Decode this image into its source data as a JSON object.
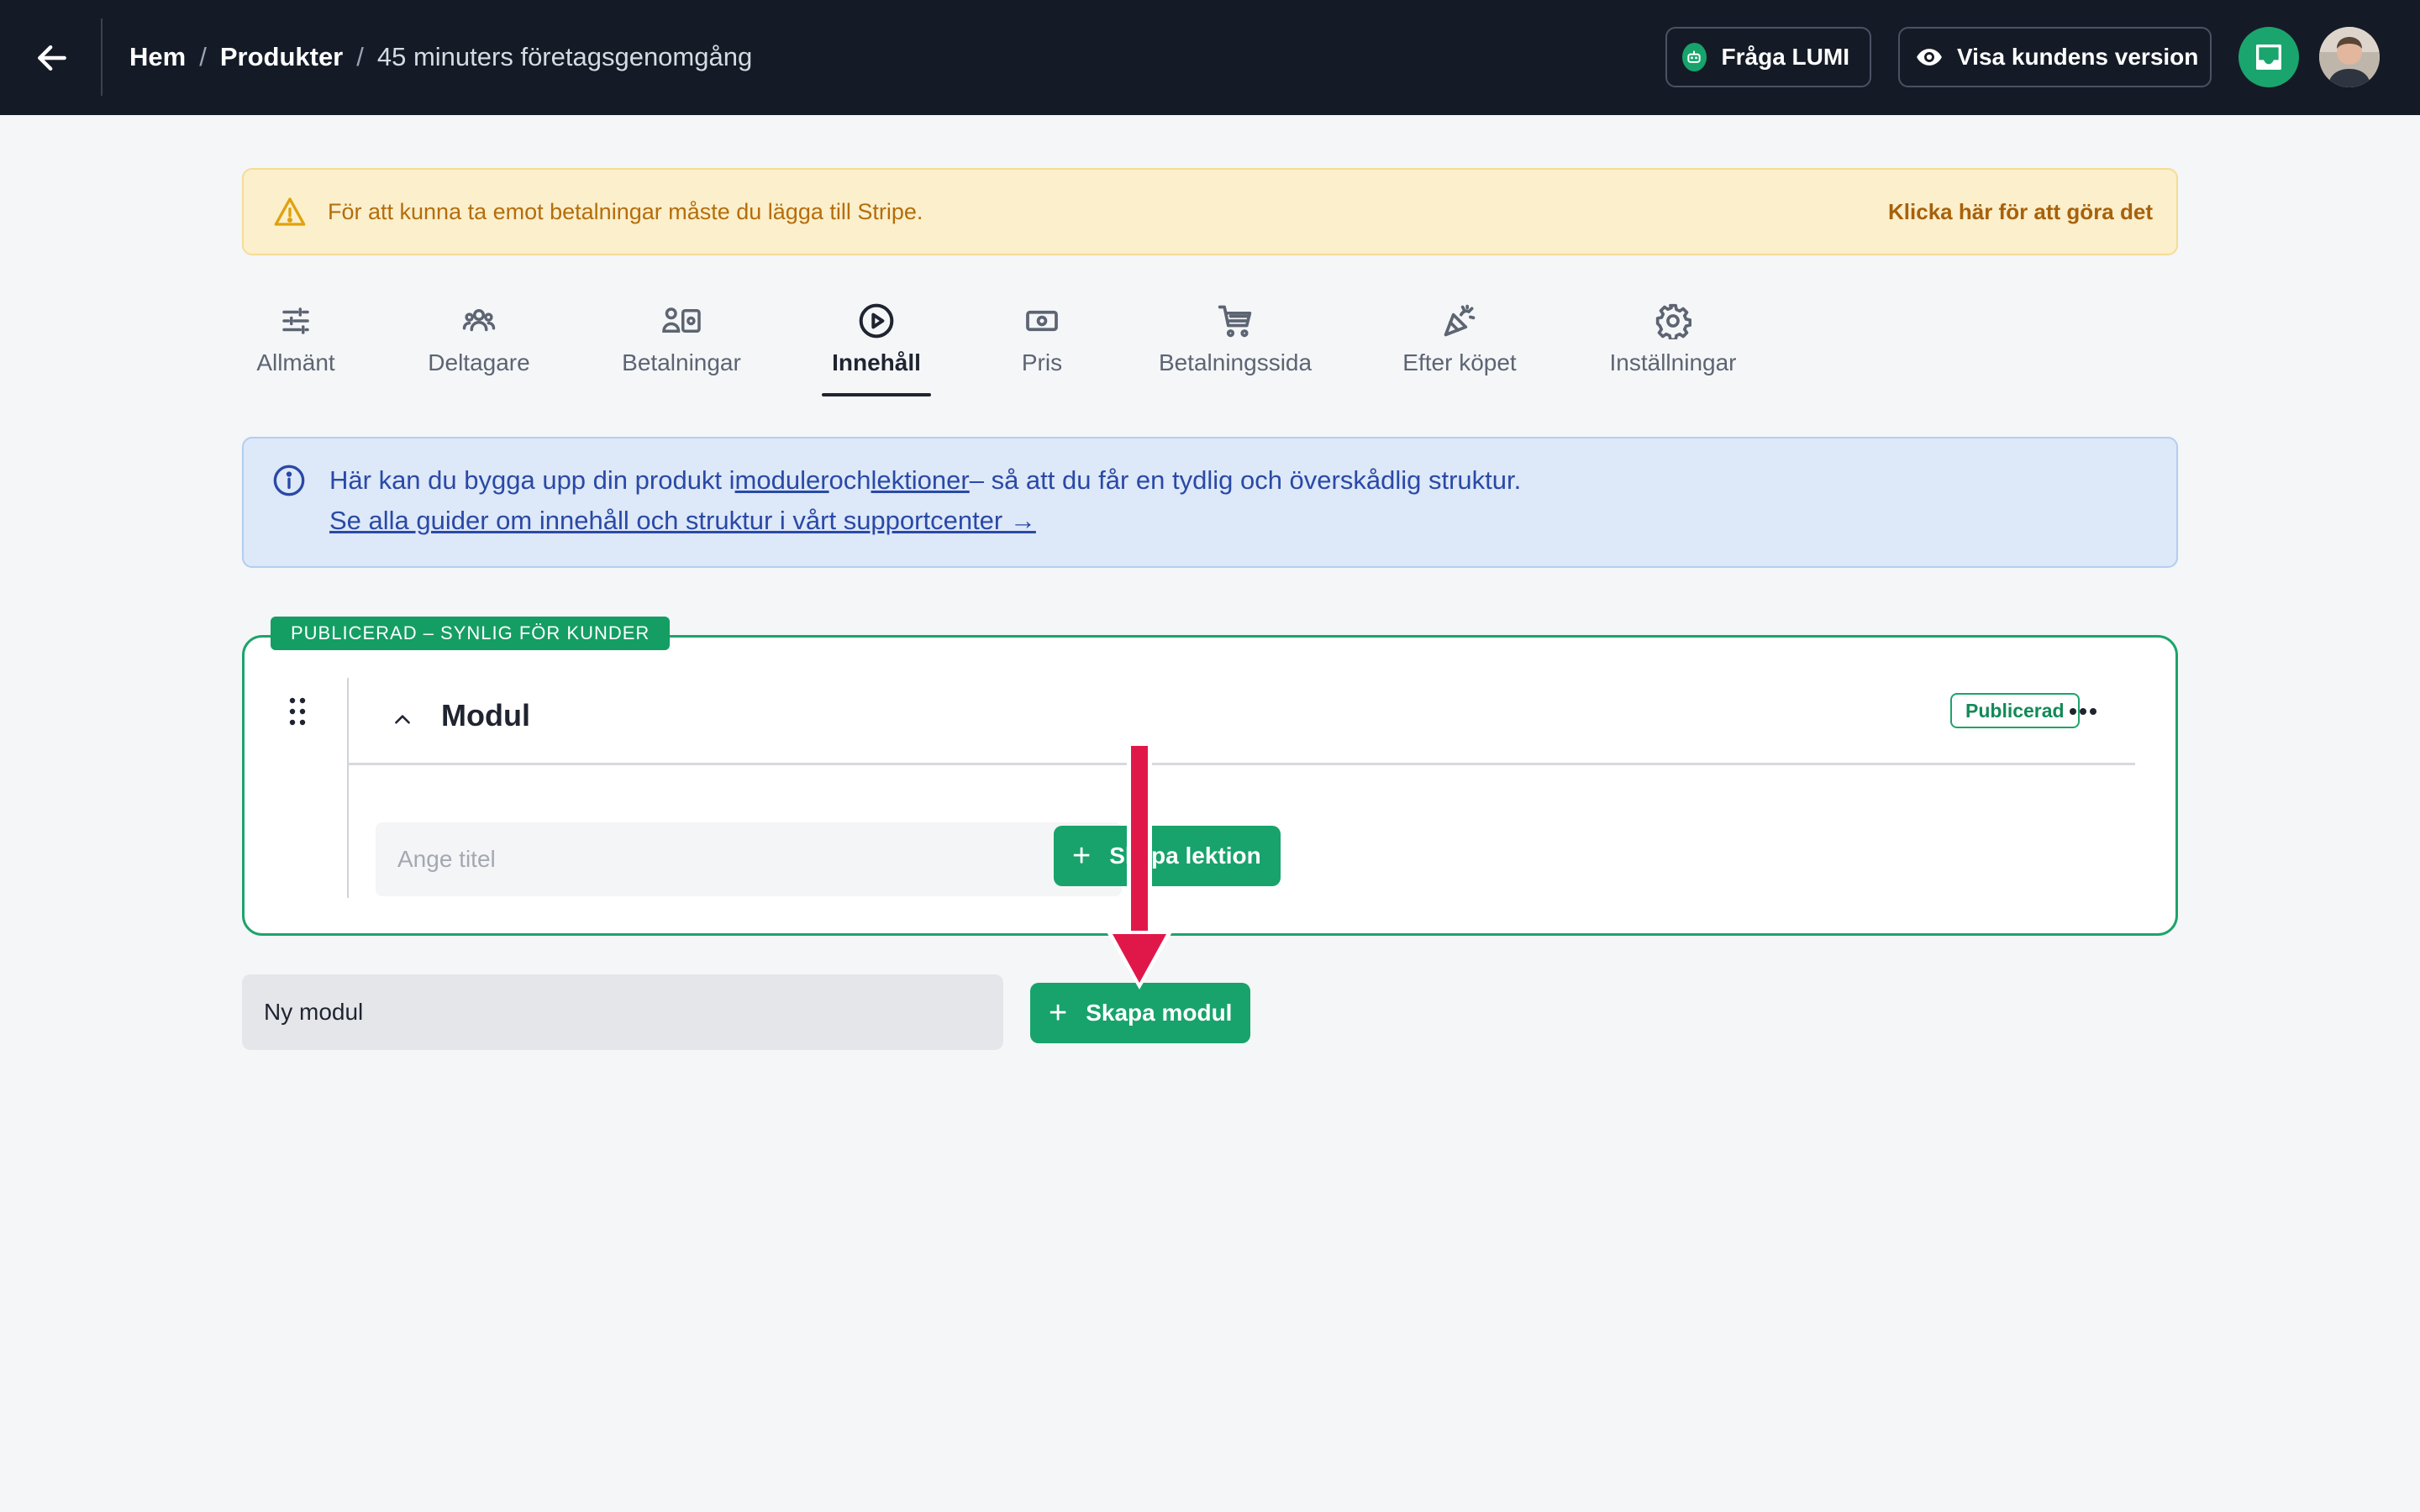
{
  "header": {
    "breadcrumb": {
      "home": "Hem",
      "products": "Produkter",
      "current": "45 minuters företagsgenomgång"
    },
    "buttons": {
      "ask_lumi": "Fråga LUMI",
      "customer_view": "Visa kundens version"
    },
    "icons": [
      "arrow-left-icon",
      "robot-icon",
      "eye-icon",
      "inbox-icon",
      "avatar"
    ]
  },
  "warning": {
    "text": "För att kunna ta emot betalningar måste du lägga till Stripe.",
    "link": "Klicka här för att göra det"
  },
  "tabs": [
    {
      "label": "Allmänt",
      "icon": "sliders-icon",
      "active": false
    },
    {
      "label": "Deltagare",
      "icon": "users-icon",
      "active": false
    },
    {
      "label": "Betalningar",
      "icon": "payments-icon",
      "active": false
    },
    {
      "label": "Innehåll",
      "icon": "play-circle-icon",
      "active": true
    },
    {
      "label": "Pris",
      "icon": "banknote-icon",
      "active": false
    },
    {
      "label": "Betalningssida",
      "icon": "cart-icon",
      "active": false
    },
    {
      "label": "Efter köpet",
      "icon": "party-icon",
      "active": false
    },
    {
      "label": "Inställningar",
      "icon": "gear-icon",
      "active": false
    }
  ],
  "info": {
    "text_start": "Här kan du bygga upp din produkt i",
    "link_modules": "moduler",
    "text_and": "och",
    "link_lessons": "lektioner",
    "text_end": "– så att du får en tydlig och överskådlig struktur.",
    "guide_link": "Se alla guider om innehåll och struktur i vårt supportcenter →"
  },
  "module": {
    "tag": "PUBLICERAD – SYNLIG FÖR KUNDER",
    "title": "Modul",
    "status": "Publicerad",
    "lesson_placeholder": "Ange titel",
    "create_lesson": "Skapa lektion"
  },
  "new_module": {
    "value": "Ny modul",
    "create_module": "Skapa modul"
  },
  "colors": {
    "accent_green": "#17a36b",
    "header_bg": "#151b26",
    "warning_text": "#b56d0a",
    "info_text": "#2a49a6",
    "annotation_red": "#e0184a"
  }
}
